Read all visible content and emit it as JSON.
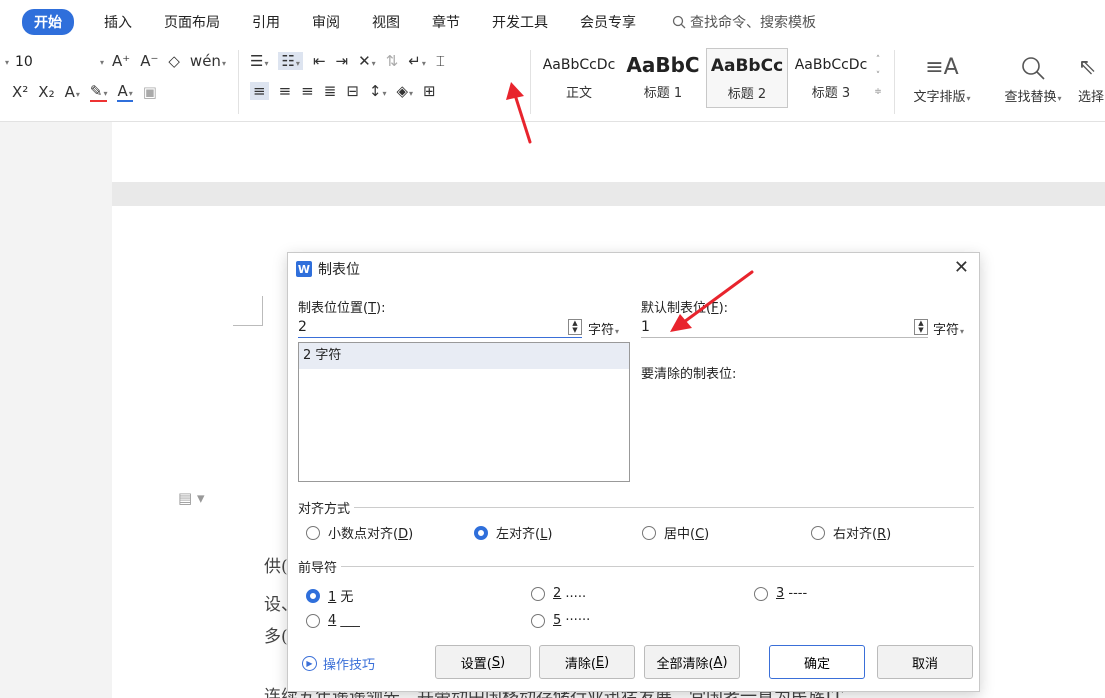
{
  "menubar": {
    "tabs": [
      "开始",
      "插入",
      "页面布局",
      "引用",
      "审阅",
      "视图",
      "章节",
      "开发工具",
      "会员专享"
    ],
    "search_label": "查找命令、搜索模板"
  },
  "ribbon": {
    "font_size": "10",
    "styles": [
      {
        "preview": "AaBbCcDc",
        "name": "正文"
      },
      {
        "preview": "AaBbC",
        "name": "标题 1"
      },
      {
        "preview": "AaBbCc",
        "name": "标题 2"
      },
      {
        "preview": "AaBbCcDc",
        "name": "标题 3"
      }
    ],
    "text_layout_label": "文字排版",
    "find_replace_label": "查找替换",
    "select_label": "选择"
  },
  "document": {
    "lines": [
      "供(",
      "设、",
      "多(",
      "连续五年遥遥领先，并带动中国移动存储行业迅猛发展，党国老一直为民族IT"
    ]
  },
  "dialog": {
    "logo": "W",
    "title": "制表位",
    "tab_position_label": "制表位位置(",
    "tab_position_key": "T",
    "tab_position_value": "2",
    "tab_position_unit": "字符",
    "tab_list": [
      "2 字符"
    ],
    "default_tab_label": "默认制表位(",
    "default_tab_key": "F",
    "default_tab_value": "1",
    "default_tab_unit": "字符",
    "clear_label": "要清除的制表位:",
    "alignment_label": "对齐方式",
    "alignment_options": [
      {
        "label": "小数点对齐(",
        "key": "D"
      },
      {
        "label": "左对齐(",
        "key": "L"
      },
      {
        "label": "居中(",
        "key": "C"
      },
      {
        "label": "右对齐(",
        "key": "R"
      }
    ],
    "alignment_selected": "左对齐",
    "leader_label": "前导符",
    "leader_options": [
      {
        "key": "1",
        "text": "无"
      },
      {
        "key": "2",
        "text": "....."
      },
      {
        "key": "3",
        "text": "----"
      },
      {
        "key": "4",
        "text": "___"
      },
      {
        "key": "5",
        "text": "······"
      }
    ],
    "leader_selected": "1 无",
    "tips_label": "操作技巧",
    "buttons": {
      "set": {
        "label": "设置(",
        "key": "S"
      },
      "clear": {
        "label": "清除(",
        "key": "E"
      },
      "clear_all": {
        "label": "全部清除(",
        "key": "A"
      },
      "ok": {
        "label": "确定"
      },
      "cancel": {
        "label": "取消"
      }
    }
  },
  "colors": {
    "accent": "#2f6fdb",
    "annotation_arrow": "#e8242d"
  }
}
